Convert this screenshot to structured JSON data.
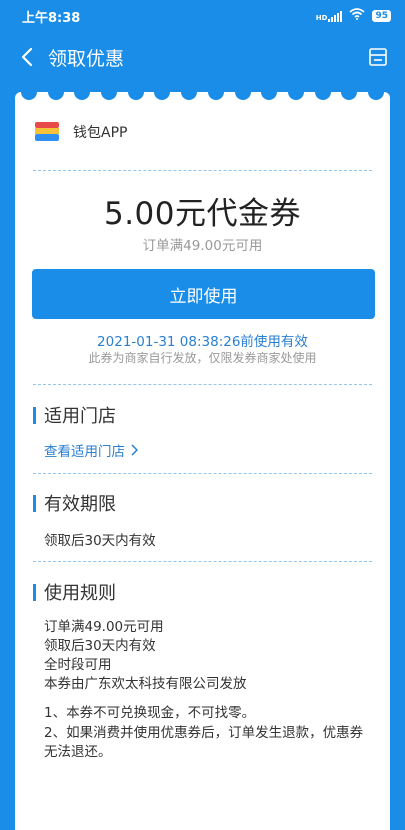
{
  "status_bar": {
    "time": "上午8:38",
    "signal_label": "HD",
    "battery": "95"
  },
  "nav": {
    "title": "领取优惠"
  },
  "coupon": {
    "merchant_name": "钱包APP",
    "amount_title": "5.00元代金券",
    "condition": "订单满49.00元可用",
    "use_button": "立即使用",
    "expire_text": "2021-01-31 08:38:26前使用有效",
    "issuer_note": "此券为商家自行发放，仅限发券商家处使用"
  },
  "sections": {
    "stores": {
      "title": "适用门店",
      "link": "查看适用门店"
    },
    "validity": {
      "title": "有效期限",
      "text": "领取后30天内有效"
    },
    "rules": {
      "title": "使用规则",
      "items": [
        "订单满49.00元可用",
        "领取后30天内有效",
        "全时段可用",
        "本券由广东欢太科技有限公司发放"
      ],
      "notes": [
        "1、本券不可兑换现金，不可找零。",
        "2、如果消费并使用优惠券后，订单发生退款，优惠券无法退还。"
      ]
    }
  },
  "colors": {
    "primary": "#1a8de8",
    "link": "#2a7fd0"
  }
}
